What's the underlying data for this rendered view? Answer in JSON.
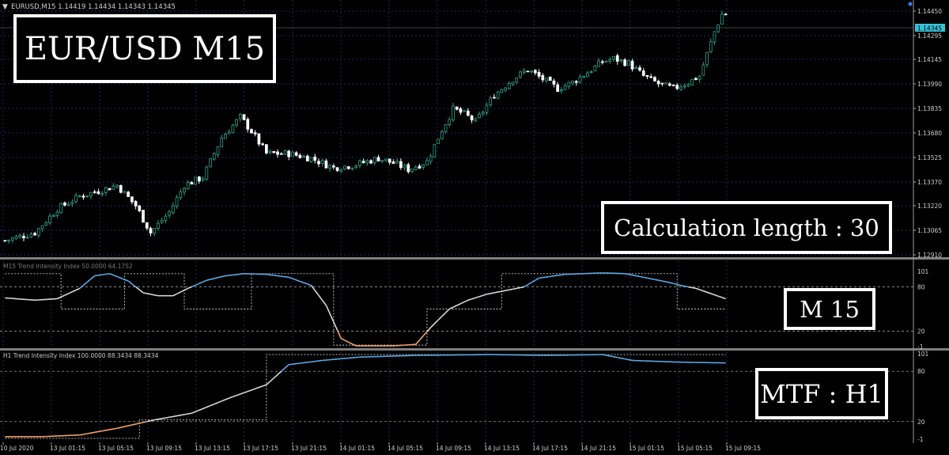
{
  "header": {
    "symbol_info": "EURUSD,M15  1.14419 1.14434 1.14343 1.14345"
  },
  "callouts": {
    "title": "EUR/USD M15",
    "calc_length": "Calculation length : 30",
    "m15": "M 15",
    "mtf": "MTF : H1"
  },
  "colors": {
    "background": "#000000",
    "grid": "#1c2a66",
    "candle_bull": "#2fa28c",
    "candle_bear": "#ffffff",
    "indicator_high": "#5aa9e6",
    "indicator_mid": "#d8d8d8",
    "indicator_low": "#f5a36a",
    "price_tag_bg": "#39c0d8",
    "separator": "#7f7f7f"
  },
  "chart_data": [
    {
      "type": "candlestick",
      "symbol": "EURUSD",
      "timeframe": "M15",
      "ohlc_last": {
        "open": 1.14419,
        "high": 1.14434,
        "low": 1.14343,
        "close": 1.14345
      },
      "current_price": "1.14345",
      "yticks": [
        "1.14450",
        "1.14295",
        "1.14145",
        "1.13990",
        "1.13835",
        "1.13680",
        "1.13525",
        "1.13370",
        "1.13220",
        "1.13065",
        "1.12910"
      ],
      "ylim": [
        1.1291,
        1.1445
      ],
      "close_path": [
        [
          0,
          1.13
        ],
        [
          8,
          1.1305
        ],
        [
          14,
          1.132
        ],
        [
          20,
          1.1328
        ],
        [
          26,
          1.1332
        ],
        [
          30,
          1.1335
        ],
        [
          35,
          1.1322
        ],
        [
          39,
          1.1305
        ],
        [
          44,
          1.1318
        ],
        [
          48,
          1.1335
        ],
        [
          53,
          1.134
        ],
        [
          58,
          1.1365
        ],
        [
          63,
          1.1378
        ],
        [
          66,
          1.1369
        ],
        [
          70,
          1.1355
        ],
        [
          76,
          1.1355
        ],
        [
          82,
          1.1352
        ],
        [
          88,
          1.1346
        ],
        [
          94,
          1.1348
        ],
        [
          100,
          1.1352
        ],
        [
          104,
          1.1349
        ],
        [
          108,
          1.1345
        ],
        [
          113,
          1.135
        ],
        [
          117,
          1.137
        ],
        [
          120,
          1.1383
        ],
        [
          123,
          1.138
        ],
        [
          126,
          1.1375
        ],
        [
          131,
          1.1392
        ],
        [
          136,
          1.1402
        ],
        [
          140,
          1.1408
        ],
        [
          144,
          1.1402
        ],
        [
          148,
          1.1396
        ],
        [
          152,
          1.14
        ],
        [
          157,
          1.1408
        ],
        [
          160,
          1.1413
        ],
        [
          163,
          1.1415
        ],
        [
          167,
          1.1412
        ],
        [
          171,
          1.1404
        ],
        [
          175,
          1.1399
        ],
        [
          179,
          1.1396
        ],
        [
          183,
          1.14
        ],
        [
          186,
          1.1404
        ],
        [
          188,
          1.1418
        ],
        [
          190,
          1.1432
        ],
        [
          192,
          1.1443
        ]
      ]
    },
    {
      "type": "line",
      "title": "M15 Trend Intensity Index 50.0000 64.1752",
      "yticks": [
        "101",
        "80",
        "20",
        "-1"
      ],
      "ylim": [
        -1,
        101
      ],
      "series": [
        {
          "values": [
            [
              0,
              65
            ],
            [
              8,
              62
            ],
            [
              14,
              64
            ],
            [
              20,
              78
            ],
            [
              24,
              95
            ],
            [
              28,
              98
            ],
            [
              33,
              88
            ],
            [
              37,
              72
            ],
            [
              41,
              68
            ],
            [
              45,
              68
            ],
            [
              49,
              78
            ],
            [
              54,
              89
            ],
            [
              59,
              95
            ],
            [
              64,
              98
            ],
            [
              70,
              97
            ],
            [
              76,
              93
            ],
            [
              82,
              82
            ],
            [
              86,
              55
            ],
            [
              90,
              10
            ],
            [
              94,
              0
            ],
            [
              104,
              0
            ],
            [
              110,
              2
            ],
            [
              114,
              25
            ],
            [
              119,
              50
            ],
            [
              124,
              62
            ],
            [
              129,
              70
            ],
            [
              134,
              75
            ],
            [
              139,
              80
            ],
            [
              143,
              92
            ],
            [
              150,
              97
            ],
            [
              160,
              99
            ],
            [
              166,
              98
            ],
            [
              172,
              92
            ],
            [
              177,
              87
            ],
            [
              181,
              82
            ],
            [
              185,
              78
            ],
            [
              189,
              71
            ],
            [
              193,
              64
            ]
          ]
        },
        {
          "dashed": true,
          "values": [
            [
              0,
              98
            ],
            [
              15,
              98
            ],
            [
              15,
              50
            ],
            [
              32,
              50
            ],
            [
              32,
              98
            ],
            [
              48,
              98
            ],
            [
              48,
              50
            ],
            [
              66,
              50
            ],
            [
              66,
              98
            ],
            [
              88,
              98
            ],
            [
              88,
              1
            ],
            [
              113,
              1
            ],
            [
              113,
              50
            ],
            [
              133,
              50
            ],
            [
              133,
              98
            ],
            [
              180,
              98
            ],
            [
              180,
              50
            ],
            [
              193,
              50
            ]
          ]
        }
      ]
    },
    {
      "type": "line",
      "title": "H1 Trend Intensity Index 100.0000 88.3434 88.3434",
      "yticks": [
        "101",
        "80",
        "20",
        "-1"
      ],
      "ylim": [
        -1,
        101
      ],
      "xticks": [
        "10 Jul 2020",
        "13 Jul 01:15",
        "13 Jul 05:15",
        "13 Jul 09:15",
        "13 Jul 13:15",
        "13 Jul 17:15",
        "13 Jul 21:15",
        "14 Jul 01:15",
        "14 Jul 05:15",
        "14 Jul 09:15",
        "14 Jul 13:15",
        "14 Jul 17:15",
        "14 Jul 21:15",
        "15 Jul 01:15",
        "15 Jul 05:15",
        "15 Jul 09:15"
      ],
      "series": [
        {
          "values": [
            [
              0,
              2
            ],
            [
              10,
              2
            ],
            [
              20,
              4
            ],
            [
              30,
              12
            ],
            [
              40,
              22
            ],
            [
              50,
              30
            ],
            [
              60,
              48
            ],
            [
              70,
              64
            ],
            [
              76,
              88
            ],
            [
              85,
              93
            ],
            [
              95,
              97
            ],
            [
              110,
              99
            ],
            [
              130,
              100
            ],
            [
              145,
              99
            ],
            [
              160,
              100
            ],
            [
              168,
              93
            ],
            [
              180,
              91
            ],
            [
              193,
              90
            ]
          ]
        },
        {
          "dashed": true,
          "values": [
            [
              0,
              0
            ],
            [
              36,
              0
            ],
            [
              36,
              22
            ],
            [
              70,
              22
            ],
            [
              70,
              100
            ],
            [
              193,
              100
            ]
          ]
        }
      ]
    }
  ]
}
